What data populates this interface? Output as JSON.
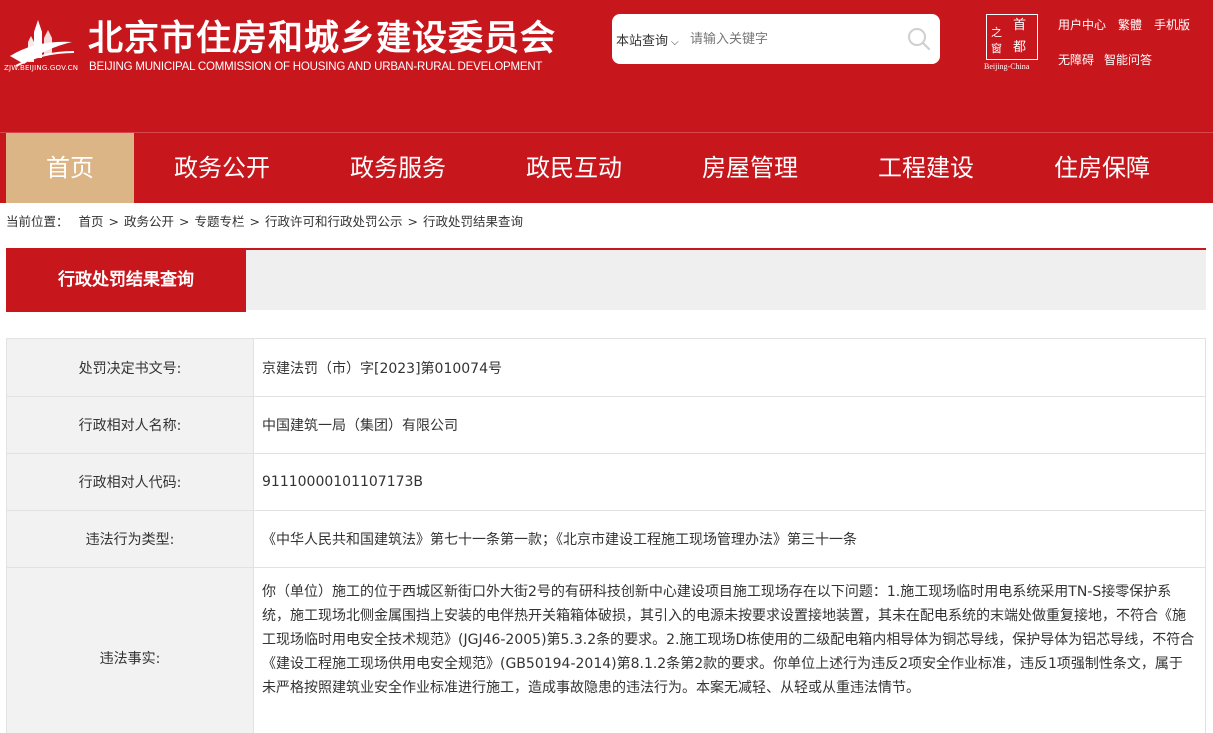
{
  "header": {
    "logo_url_text": "ZJW.BEIJING.GOV.CN",
    "title": "北京市住房和城乡建设委员会",
    "subtitle": "BEIJING MUNICIPAL COMMISSION OF HOUSING AND URBAN-RURAL DEVELOPMENT",
    "search": {
      "scope_selected": "本站查询",
      "placeholder": "请输入关键字"
    },
    "capital_logo": {
      "chars": [
        "首",
        "都",
        "之",
        "窗"
      ],
      "caption": "Beijing-China"
    },
    "links_row1": [
      "用户中心",
      "繁體",
      "手机版"
    ],
    "links_row2": [
      "无障碍",
      "智能问答"
    ]
  },
  "nav": {
    "items": [
      "首页",
      "政务公开",
      "政务服务",
      "政民互动",
      "房屋管理",
      "工程建设",
      "住房保障"
    ],
    "active": "首页"
  },
  "breadcrumb": {
    "prefix": "当前位置：",
    "items": [
      "首页",
      "政务公开",
      "专题专栏",
      "行政许可和行政处罚公示",
      "行政处罚结果查询"
    ]
  },
  "section": {
    "title": "行政处罚结果查询"
  },
  "details": [
    {
      "label": "处罚决定书文号:",
      "value": "京建法罚（市）字[2023]第010074号"
    },
    {
      "label": "行政相对人名称:",
      "value": "中国建筑一局（集团）有限公司"
    },
    {
      "label": "行政相对人代码:",
      "value": "91110000101107173B"
    },
    {
      "label": "违法行为类型:",
      "value": "《中华人民共和国建筑法》第七十一条第一款；《北京市建设工程施工现场管理办法》第三十一条"
    },
    {
      "label": "违法事实:",
      "value": "你（单位）施工的位于西城区新街口外大街2号的有研科技创新中心建设项目施工现场存在以下问题：1.施工现场临时用电系统采用TN-S接零保护系统，施工现场北侧金属围挡上安装的电伴热开关箱箱体破损，其引入的电源未按要求设置接地装置，其未在配电系统的末端处做重复接地，不符合《施工现场临时用电安全技术规范》(JGJ46-2005)第5.3.2条的要求。2.施工现场D栋使用的二级配电箱内相导体为铜芯导线，保护导体为铝芯导线，不符合《建设工程施工现场供用电安全规范》(GB50194-2014)第8.1.2条第2款的要求。你单位上述行为违反2项安全作业标准，违反1项强制性条文，属于未严格按照建筑业安全作业标准进行施工，造成事故隐患的违法行为。本案无减轻、从轻或从重违法情节。"
    }
  ],
  "colors": {
    "brand_red": "#c8161d",
    "nav_active": "#dcb586",
    "label_bg": "#f2f2f2",
    "section_bg": "#efefef"
  }
}
